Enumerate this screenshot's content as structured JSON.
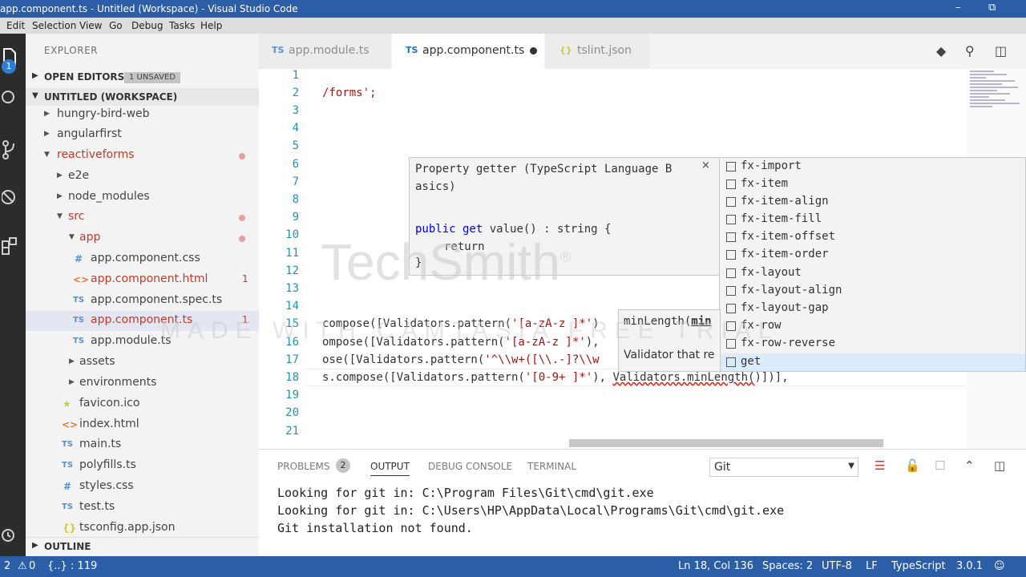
{
  "window": {
    "title": "app.component.ts - Untitled (Workspace) - Visual Studio Code",
    "minimize": "–",
    "restore": "⧉"
  },
  "menu": [
    "Edit",
    "Selection",
    "View",
    "Go",
    "Debug",
    "Tasks",
    "Help"
  ],
  "activity": {
    "scm_badge": "1",
    "icons": [
      "files-icon",
      "search-icon",
      "source-control-icon",
      "debug-icon",
      "extensions-icon",
      "settings-icon"
    ]
  },
  "explorer": {
    "header": "EXPLORER",
    "open_editors": {
      "label": "OPEN EDITORS",
      "badge": "1 UNSAVED"
    },
    "workspace": {
      "label": "UNTITLED (WORKSPACE)"
    },
    "outline": {
      "label": "OUTLINE"
    },
    "tree": [
      {
        "label": "hungry-bird-web",
        "type": "folder"
      },
      {
        "label": "angularfirst",
        "type": "folder"
      },
      {
        "label": "reactiveforms",
        "type": "folder-open"
      },
      {
        "label": "e2e",
        "type": "folder"
      },
      {
        "label": "node_modules",
        "type": "folder"
      },
      {
        "label": "src",
        "type": "folder-open"
      },
      {
        "label": "app",
        "type": "folder-open"
      },
      {
        "label": "app.component.css",
        "type": "css",
        "icon": "#"
      },
      {
        "label": "app.component.html",
        "type": "html",
        "icon": "<>",
        "problems": "1"
      },
      {
        "label": "app.component.spec.ts",
        "type": "ts",
        "icon": "TS"
      },
      {
        "label": "app.component.ts",
        "type": "ts",
        "icon": "TS",
        "problems": "1"
      },
      {
        "label": "app.module.ts",
        "type": "ts",
        "icon": "TS"
      },
      {
        "label": "assets",
        "type": "folder"
      },
      {
        "label": "environments",
        "type": "folder"
      },
      {
        "label": "favicon.ico",
        "type": "ico",
        "icon": "★"
      },
      {
        "label": "index.html",
        "type": "html",
        "icon": "<>"
      },
      {
        "label": "main.ts",
        "type": "ts",
        "icon": "TS"
      },
      {
        "label": "polyfills.ts",
        "type": "ts",
        "icon": "TS"
      },
      {
        "label": "styles.css",
        "type": "css",
        "icon": "#"
      },
      {
        "label": "test.ts",
        "type": "ts",
        "icon": "TS"
      },
      {
        "label": "tsconfig.app.json",
        "type": "json",
        "icon": "{}"
      }
    ]
  },
  "tabs": [
    {
      "label": "app.module.ts",
      "icon": "TS"
    },
    {
      "label": "app.component.ts",
      "icon": "TS",
      "active": true,
      "dirty": true
    },
    {
      "label": "tslint.json",
      "icon": "{}"
    }
  ],
  "editor": {
    "line_numbers": [
      "1",
      "2",
      "3",
      "4",
      "5",
      "6",
      "7",
      "8",
      "9",
      "10",
      "11",
      "12",
      "13",
      "14",
      "15",
      "16",
      "17",
      "18",
      "19",
      "20",
      "21"
    ],
    "lines": {
      "l2": "/forms';",
      "l15a": "compose([Validators.pattern(",
      "l15s": "'[a-zA-z ]*'",
      "l15b": ")",
      "l16a": "ompose([Validators.pattern(",
      "l16s": "'[a-zA-z ]*'",
      "l16b": "),",
      "l17a": "ose([Validators.pattern(",
      "l17s": "'^\\\\w+([\\\\.-]?\\\\w",
      "l18a": "s.compose([Validators.pattern(",
      "l18s": "'[0-9+ ]*'",
      "l18b": "), ",
      "l18c": "Validators.minLength(",
      "l18d": ")])],"
    }
  },
  "hover": {
    "line1": "Property getter (TypeScript Language B",
    "line2": "asics)",
    "code_kw1": "public get",
    "code_rest": " value() : string {",
    "code_return": "return",
    "code_close": "}",
    "close": "×"
  },
  "suggest": [
    "fx-import",
    "fx-item",
    "fx-item-align",
    "fx-item-fill",
    "fx-item-offset",
    "fx-item-order",
    "fx-layout",
    "fx-layout-align",
    "fx-layout-gap",
    "fx-row",
    "fx-row-reverse",
    "get"
  ],
  "param_hint": {
    "sig_pre": "minLength(",
    "sig_param": "min",
    "doc": "Validator that re"
  },
  "watermark": {
    "brand": "TechSmith",
    "reg": "®",
    "tagline": "MADE WITH CAMTASIA FREE TRIAL"
  },
  "panel": {
    "tabs": [
      "PROBLEMS",
      "OUTPUT",
      "DEBUG CONSOLE",
      "TERMINAL"
    ],
    "problems_count": "2",
    "channel": "Git",
    "output": [
      "Looking for git in: C:\\Program Files\\Git\\cmd\\git.exe",
      "Looking for git in: C:\\Users\\HP\\AppData\\Local\\Programs\\Git\\cmd\\git.exe",
      "Git installation not found."
    ]
  },
  "status": {
    "branch_sync": "2",
    "warnings": "0",
    "symbol": "{..} : 119",
    "position": "Ln 18, Col 136",
    "spaces": "Spaces: 2",
    "encoding": "UTF-8",
    "eol": "LF",
    "language": "TypeScript",
    "version": "3.0.1"
  }
}
